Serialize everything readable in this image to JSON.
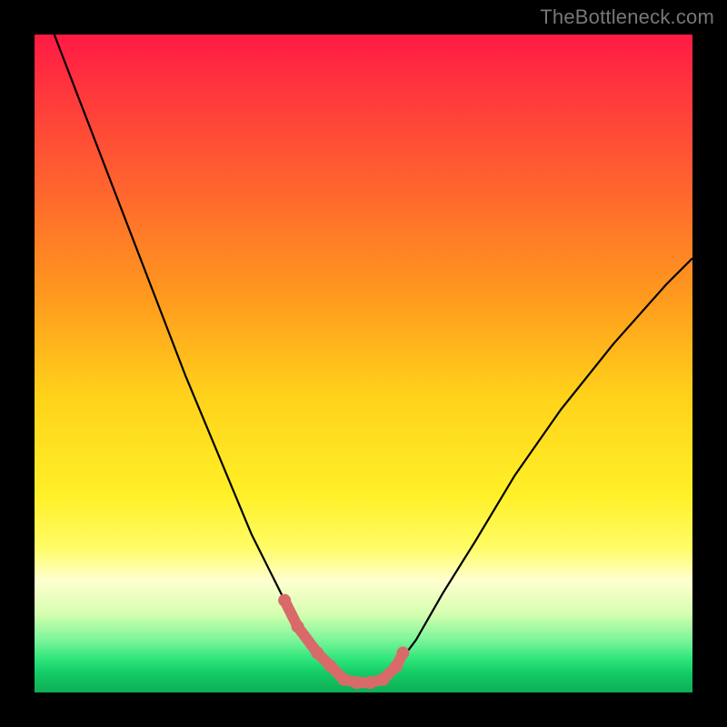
{
  "watermark": "TheBottleneck.com",
  "chart_data": {
    "type": "line",
    "title": "",
    "xlabel": "",
    "ylabel": "",
    "xlim": [
      0,
      100
    ],
    "ylim": [
      0,
      100
    ],
    "grid": false,
    "series": [
      {
        "name": "curve",
        "color": "#000000",
        "x": [
          3,
          8,
          13,
          18,
          23,
          28,
          33,
          36,
          38,
          40,
          43,
          45,
          47,
          49,
          51,
          53,
          55,
          58,
          62,
          67,
          73,
          80,
          88,
          96,
          100
        ],
        "y": [
          100,
          87,
          74,
          61,
          48,
          36,
          24,
          18,
          14,
          10,
          6,
          4,
          2,
          1.5,
          1.5,
          2,
          4,
          8,
          15,
          23,
          33,
          43,
          53,
          62,
          66
        ]
      },
      {
        "name": "highlight",
        "color": "#d96a6a",
        "x": [
          38,
          40,
          43,
          45,
          47,
          49,
          51,
          53,
          55,
          56
        ],
        "y": [
          14,
          10,
          6,
          4,
          2,
          1.5,
          1.5,
          2,
          4,
          6
        ]
      }
    ],
    "highlight_points": {
      "color": "#d96a6a",
      "x": [
        38,
        40,
        43,
        45,
        47,
        49,
        51,
        53,
        55,
        56
      ],
      "y": [
        14,
        10,
        6,
        4,
        2,
        1.5,
        1.5,
        2,
        4,
        6
      ]
    },
    "background_gradient_stops": [
      {
        "pos": 0,
        "color": "#ff1a44"
      },
      {
        "pos": 25,
        "color": "#ff6a2c"
      },
      {
        "pos": 55,
        "color": "#ffd21a"
      },
      {
        "pos": 78,
        "color": "#fffc66"
      },
      {
        "pos": 88,
        "color": "#d6ffb0"
      },
      {
        "pos": 100,
        "color": "#0fae55"
      }
    ]
  }
}
